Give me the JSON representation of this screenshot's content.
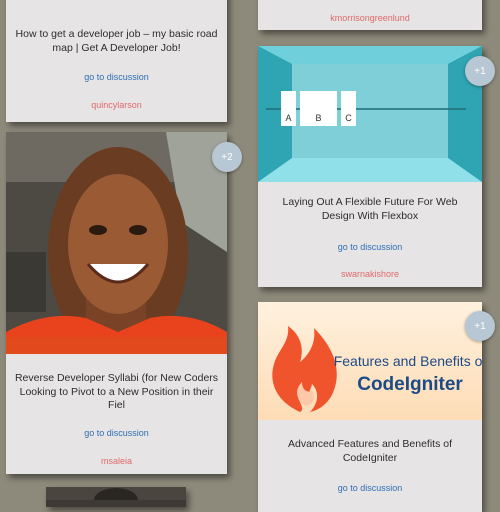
{
  "cards": [
    {
      "title": "How to get a developer job – my basic road map | Get A Developer Job!",
      "link": "go to discussion",
      "author": "quincylarson"
    },
    {
      "author": "kmorrisongreenlund"
    },
    {
      "title": "Reverse Developer Syllabi (for New Coders Looking to Pivot to a New Position in their Fiel",
      "link": "go to discussion",
      "author": "msaleia",
      "badge": "+2"
    },
    {
      "title": "Laying Out A Flexible Future For Web Design With Flexbox",
      "link": "go to discussion",
      "author": "swarnakishore",
      "badge": "+1",
      "image_labels": [
        "A",
        "B",
        "C"
      ]
    },
    {
      "title": "Advanced Features and Benefits of CodeIgniter",
      "link": "go to discussion",
      "badge": "+1",
      "image_text_line1": "Features and Benefits of",
      "image_text_line2": "CodeIgniter"
    }
  ],
  "colors": {
    "background": "#8e8a7b",
    "card": "#e6e4e4",
    "link": "#2f6fb5",
    "author": "#e06a6a",
    "badge": "#b7c7d3",
    "flexbox_teal": "#3fb6c4",
    "codeigniter_orange": "#f0542c"
  }
}
